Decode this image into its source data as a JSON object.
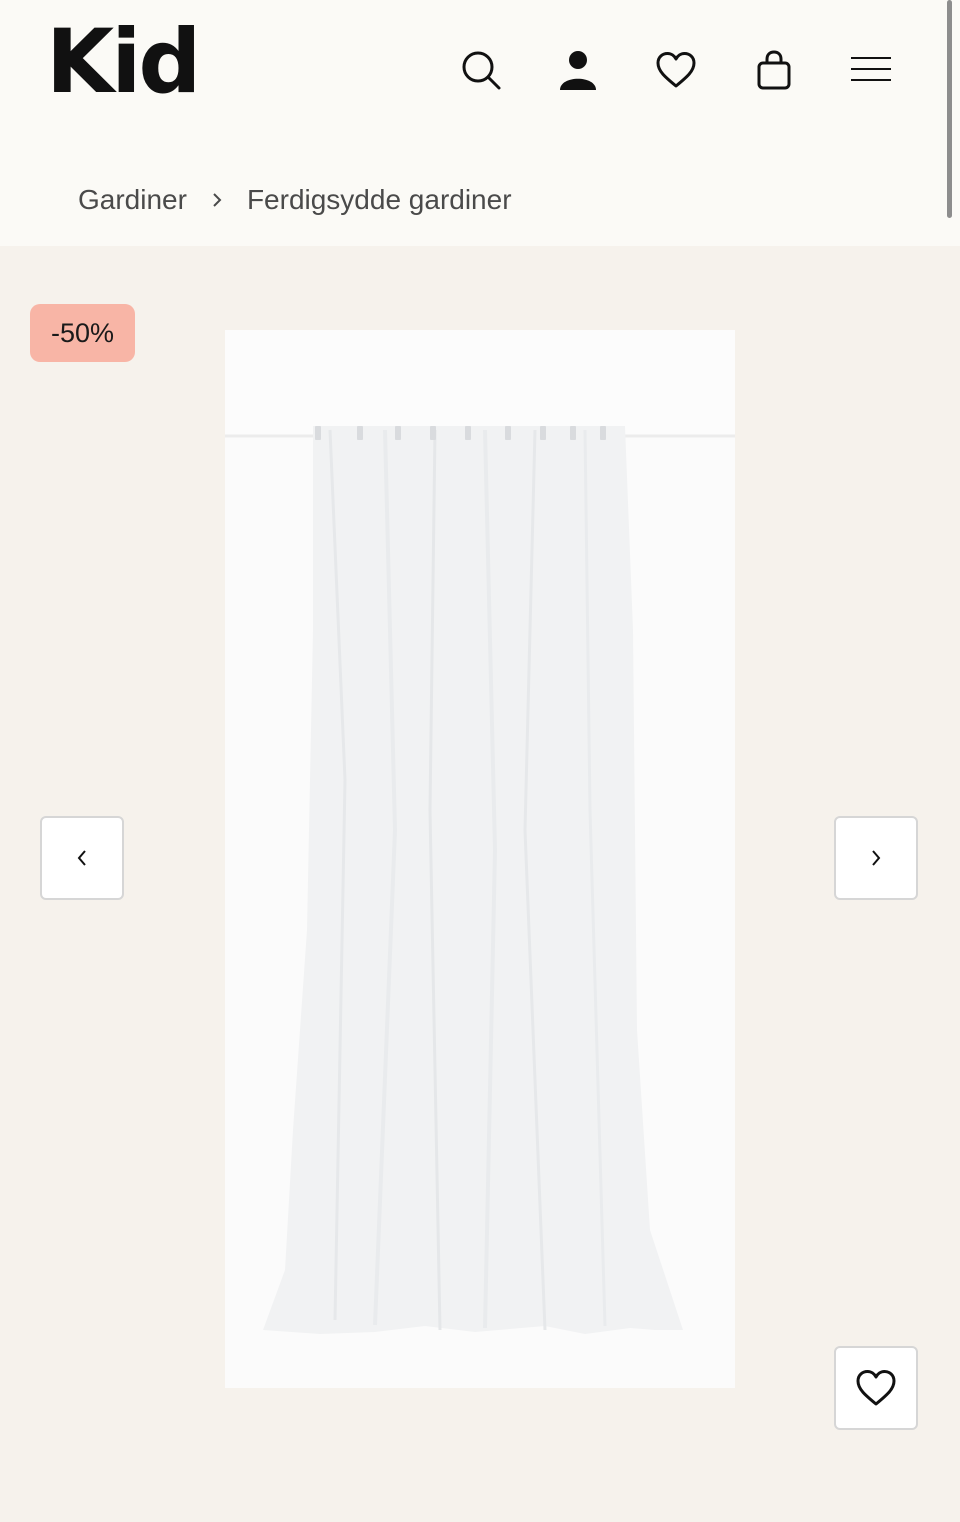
{
  "header": {
    "logo": "Kid",
    "icons": [
      "search-icon",
      "account-icon",
      "wishlist-icon",
      "cart-icon",
      "menu-icon"
    ]
  },
  "breadcrumb": {
    "items": [
      "Gardiner",
      "Ferdigsydde gardiner"
    ]
  },
  "product": {
    "discount_badge": "-50%",
    "image_description": "white sheer curtain"
  },
  "gallery": {
    "prev_icon": "chevron-left-icon",
    "next_icon": "chevron-right-icon",
    "favorite_icon": "heart-icon"
  },
  "colors": {
    "header_bg": "#fbfaf6",
    "page_bg": "#f6f2ec",
    "badge_bg": "#f8b5a6",
    "text": "#111111"
  }
}
